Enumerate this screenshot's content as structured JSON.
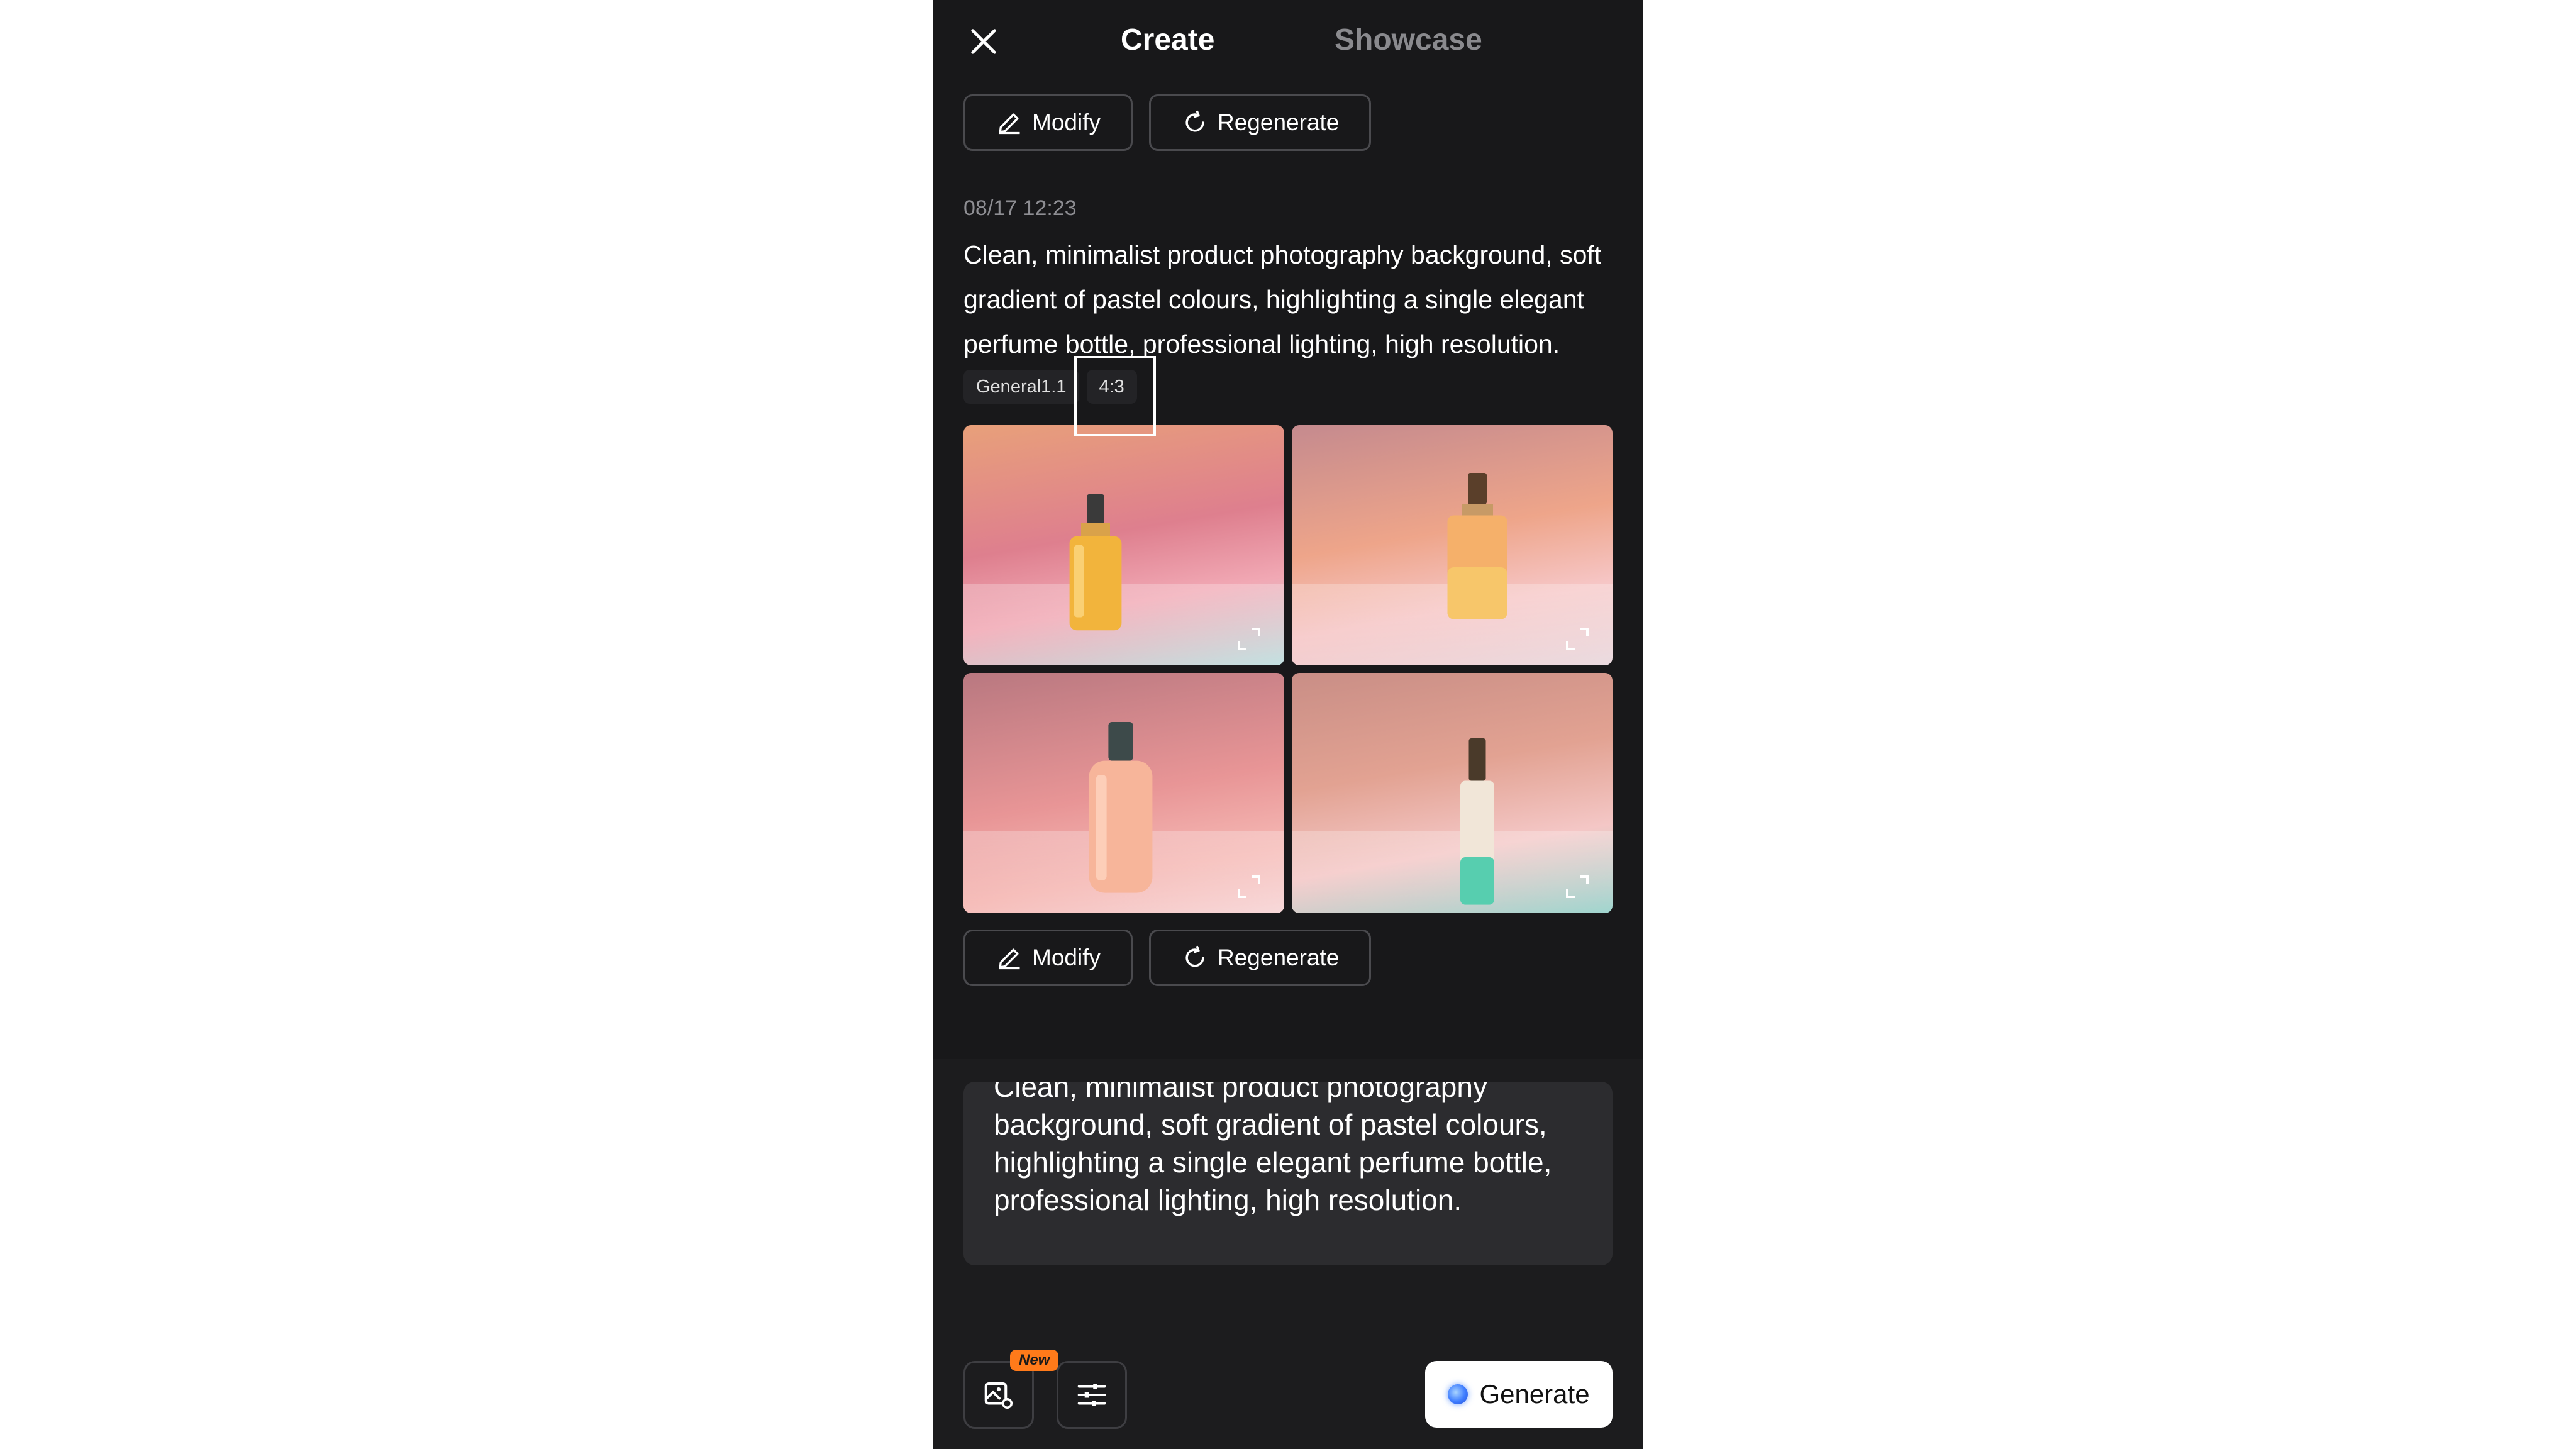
{
  "header": {
    "close_icon": "close-icon",
    "tabs": [
      {
        "label": "Create",
        "active": true
      },
      {
        "label": "Showcase",
        "active": false
      }
    ]
  },
  "actions_top": {
    "modify_label": "Modify",
    "regenerate_label": "Regenerate"
  },
  "entry": {
    "timestamp": "08/17 12:23",
    "prompt": "Clean, minimalist product photography background, soft gradient of pastel colours, highlighting a single elegant perfume bottle, professional lighting, high resolution.",
    "tags": [
      "General1.1",
      "4:3"
    ]
  },
  "images": [
    {
      "name": "generated-image-1",
      "expand_icon": "expand-icon"
    },
    {
      "name": "generated-image-2",
      "expand_icon": "expand-icon"
    },
    {
      "name": "generated-image-3",
      "expand_icon": "expand-icon"
    },
    {
      "name": "generated-image-4",
      "expand_icon": "expand-icon"
    }
  ],
  "actions_bottom": {
    "modify_label": "Modify",
    "regenerate_label": "Regenerate"
  },
  "composer": {
    "prompt_value": "Clean, minimalist product photography background, soft gradient of pastel colours, highlighting a single elegant perfume bottle, professional lighting, high resolution.",
    "new_badge": "New",
    "generate_label": "Generate"
  },
  "colors": {
    "background": "#18181a",
    "badge_orange": "#ff7a1a",
    "button_border": "#4a4a4e",
    "muted_text": "#8e8e93"
  }
}
